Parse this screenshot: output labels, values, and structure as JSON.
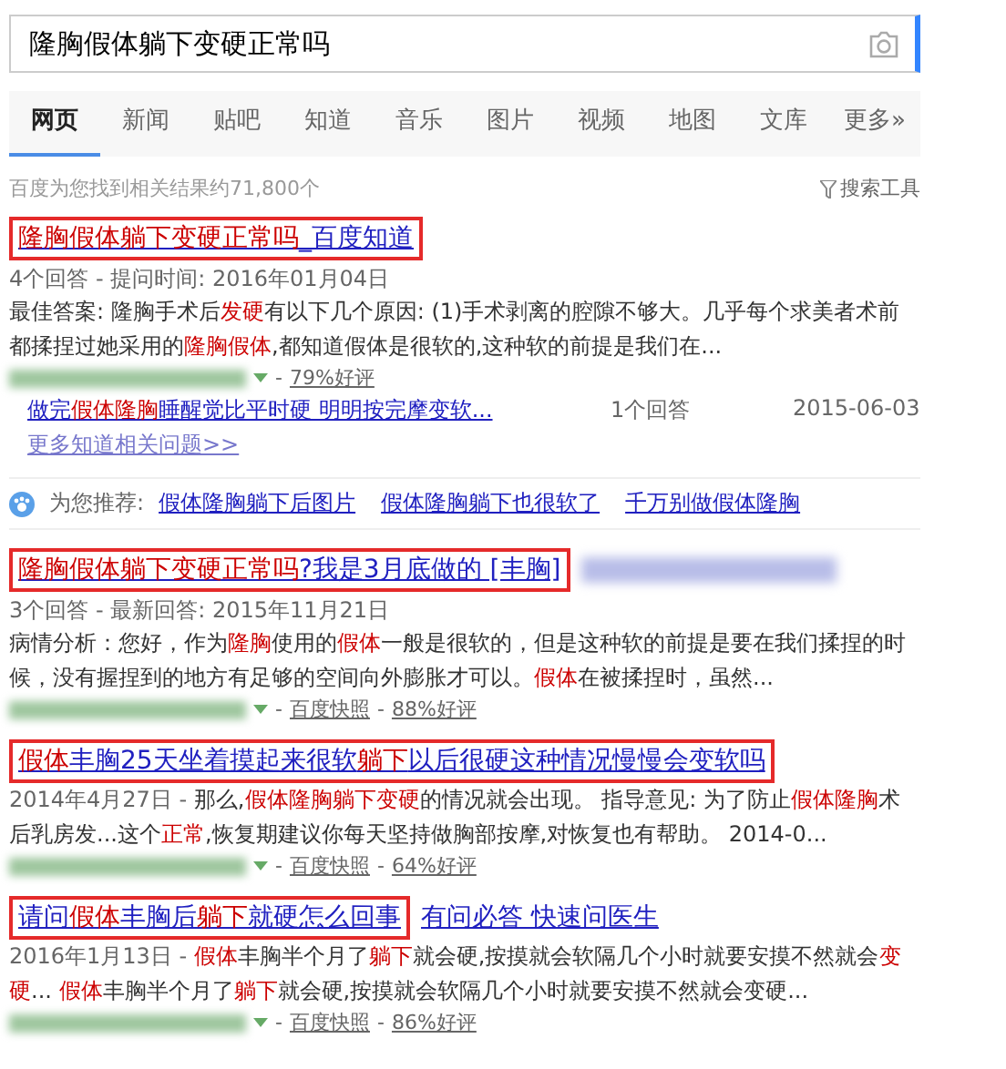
{
  "search": {
    "value": "隆胸假体躺下变硬正常吗"
  },
  "tabs": [
    {
      "label": "网页",
      "selected": true
    },
    {
      "label": "新闻",
      "selected": false
    },
    {
      "label": "贴吧",
      "selected": false
    },
    {
      "label": "知道",
      "selected": false
    },
    {
      "label": "音乐",
      "selected": false
    },
    {
      "label": "图片",
      "selected": false
    },
    {
      "label": "视频",
      "selected": false
    },
    {
      "label": "地图",
      "selected": false
    },
    {
      "label": "文库",
      "selected": false
    },
    {
      "label": "更多»",
      "selected": false
    }
  ],
  "result_count": "百度为您找到相关结果约71,800个",
  "search_tools": "搜索工具",
  "results": [
    {
      "kind": "answer",
      "title": "**隆胸假体躺下变硬正常吗**_百度知道",
      "boxed": true,
      "meta": "4个回答 - 提问时间: 2016年01月04日",
      "snippet": "最佳答案: 隆胸手术后**发硬**有以下几个原因: (1)手术剥离的腔隙不够大。几乎每个求美者术前都揉捏过她采用的**隆胸假体**,都知道假体是很软的,这种软的前提是我们在...",
      "separators": [
        "-"
      ],
      "rating": "79%好评",
      "related": {
        "title": "做完**假体隆胸**睡醒觉比平时硬 明明按完摩变软...",
        "count": "1个回答",
        "date": "2015-06-03"
      },
      "more": "更多知道相关问题>>"
    },
    {
      "kind": "recommend",
      "label": "为您推荐:",
      "links": [
        "假体隆胸躺下后图片",
        "假体隆胸躺下也很软了",
        "千万别做假体隆胸"
      ]
    },
    {
      "kind": "answer",
      "title": "**隆胸假体躺下变硬正常吗**?我是3月底做的 [丰胸]",
      "boxed": true,
      "blurred_tail": true,
      "meta": "3个回答 - 最新回答: 2015年11月21日",
      "snippet": "病情分析：您好，作为**隆胸**使用的**假体**一般是很软的，但是这种软的前提是要在我们揉捏的时候，没有握捏到的地方有足够的空间向外膨胀才可以。**假体**在被揉捏时，虽然...",
      "separators": [
        "-",
        "-"
      ],
      "cache": "百度快照",
      "rating": "88%好评"
    },
    {
      "kind": "web",
      "title": "**假体**丰胸25天坐着摸起来很软**躺下**以后很硬这种情况慢慢会变软吗",
      "boxed": true,
      "date": "2014年4月27日 -",
      "snippet": "那么,**假体隆胸躺下变硬**的情况就会出现。 指导意见: 为了防止**假体隆胸**术后乳房发...这个**正常**,恢复期建议你每天坚持做胸部按摩,对恢复也有帮助。 2014-0...",
      "separators": [
        "-",
        "-"
      ],
      "cache": "百度快照",
      "rating": "64%好评"
    },
    {
      "kind": "web",
      "title": "请问**假体**丰胸后**躺下**就硬怎么回事",
      "title_suffix": "有问必答 快速问医生",
      "boxed": true,
      "date": "2016年1月13日 -",
      "snippet": "**假体**丰胸半个月了**躺下**就会硬,按摸就会软隔几个小时就要安摸不然就会**变硬**... **假体**丰胸半个月了**躺下**就会硬,按摸就会软隔几个小时就要安摸不然就会变硬...",
      "separators": [
        "-",
        "-"
      ],
      "cache": "百度快照",
      "rating": "86%好评"
    }
  ]
}
